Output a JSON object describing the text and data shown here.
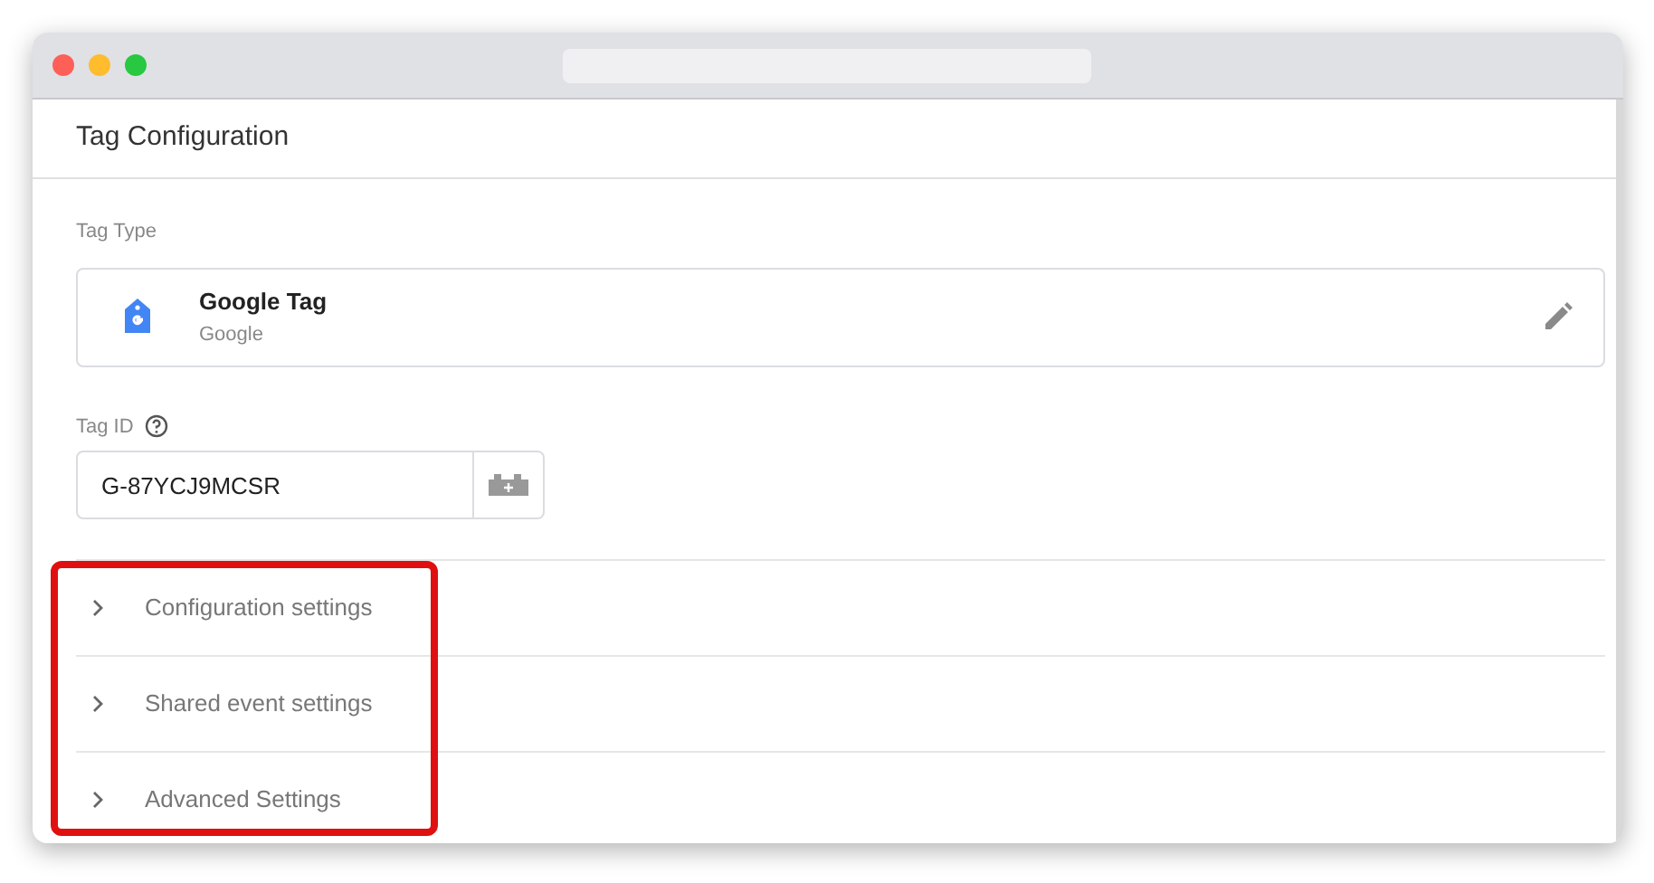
{
  "header": {
    "title": "Tag Configuration"
  },
  "tag_type": {
    "label": "Tag Type",
    "name": "Google Tag",
    "vendor": "Google"
  },
  "tag_id": {
    "label": "Tag ID",
    "value": "G-87YCJ9MCSR"
  },
  "sections": [
    {
      "label": "Configuration settings",
      "expanded": false
    },
    {
      "label": "Shared event settings",
      "expanded": false
    },
    {
      "label": "Advanced Settings",
      "expanded": false
    }
  ],
  "highlight": {
    "color": "#e01010"
  }
}
